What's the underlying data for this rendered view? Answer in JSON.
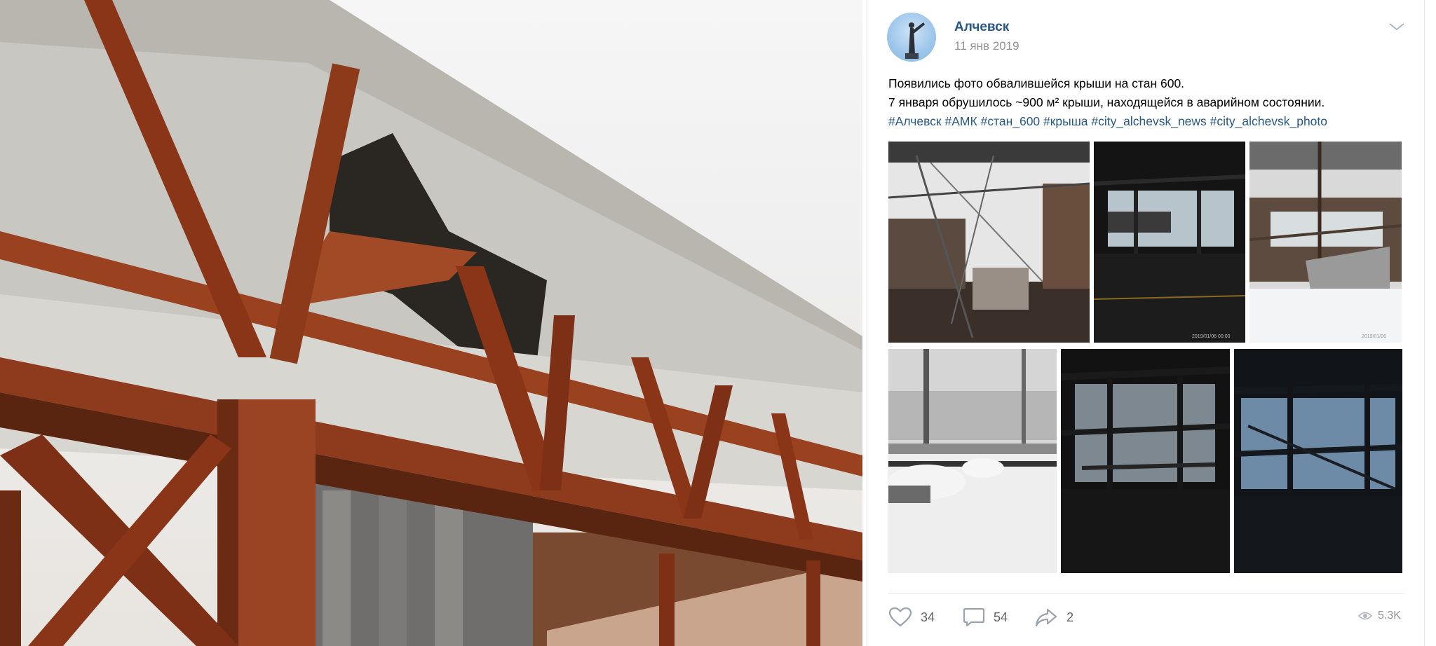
{
  "post": {
    "author": "Алчевск",
    "date": "11 янв 2019",
    "text_lines": [
      "Появились фото обвалившейся крыши на стан 600.",
      "7 января обрушилось ~900 м² крыши, находящейся в аварийном состоянии."
    ],
    "hashtags": [
      "#Алчевск",
      "#АМК",
      "#стан_600",
      "#крыша",
      "#city_alchevsk_news",
      "#city_alchevsk_photo"
    ],
    "photos": [
      {
        "name": "photo-1",
        "scene": "collapsed-roof-daylight"
      },
      {
        "name": "photo-2",
        "scene": "dark-hall-collapse"
      },
      {
        "name": "photo-3",
        "scene": "collapsed-roof-snow"
      },
      {
        "name": "photo-4",
        "scene": "snow-yard"
      },
      {
        "name": "photo-5",
        "scene": "dark-hall-frame"
      },
      {
        "name": "photo-6",
        "scene": "dark-hall-frame-blue"
      }
    ],
    "photo2_timestamp": "2019/01/06  00:00",
    "photo3_timestamp": "2019/01/06"
  },
  "actions": {
    "likes": "34",
    "comments": "54",
    "shares": "2",
    "views": "5.3K"
  },
  "icons": {
    "like": "heart-icon",
    "comment": "comment-icon",
    "share": "share-icon",
    "views": "eye-icon",
    "menu": "chevron-down-icon"
  },
  "colors": {
    "link": "#2a5885",
    "muted": "#939393",
    "rust": "#8e3a1c"
  }
}
